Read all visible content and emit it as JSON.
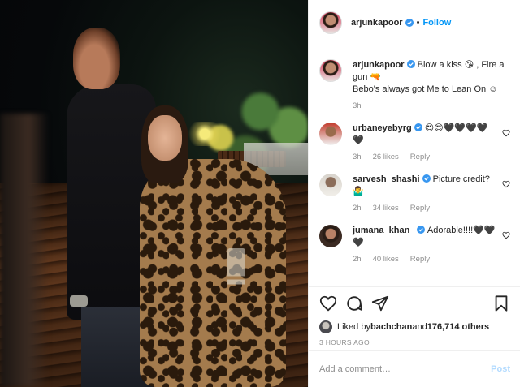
{
  "post": {
    "author": "arjunkapoor",
    "follow_label": "Follow",
    "separator": "•"
  },
  "caption": {
    "username": "arjunkapoor",
    "text_line1": " Blow a kiss 😘 , Fire a gun 🔫",
    "text_line2": "Bebo's always got Me to Lean On ☺",
    "time": "3h"
  },
  "comments": [
    {
      "username": "urbaneyebyrg",
      "text": " 😍😍🖤🖤🖤🖤🖤",
      "time": "3h",
      "likes": "26 likes",
      "reply": "Reply"
    },
    {
      "username": "sarvesh_shashi",
      "text": " Picture credit? 🤷‍♂️",
      "time": "2h",
      "likes": "34 likes",
      "reply": "Reply"
    },
    {
      "username": "jumana_khan_",
      "text": " Adorable!!!!🖤🖤🖤",
      "time": "2h",
      "likes": "40 likes",
      "reply": "Reply"
    }
  ],
  "liked_by": {
    "prefix": "Liked by ",
    "user": "bachchan",
    "middle": " and ",
    "others": "176,714 others"
  },
  "timestamp": "3 HOURS AGO",
  "add_comment": {
    "placeholder": "Add a comment…",
    "post_label": "Post"
  },
  "colors": {
    "accent": "#0095f6",
    "post_disabled": "#b3dbff",
    "muted": "#8e8e8e"
  },
  "icons": [
    "verified-icon",
    "heart-icon",
    "comment-icon",
    "share-icon",
    "bookmark-icon"
  ]
}
